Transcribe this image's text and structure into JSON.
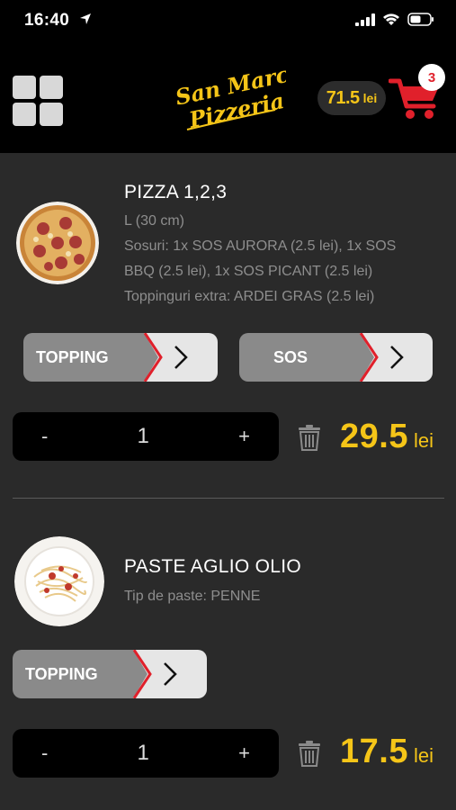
{
  "status": {
    "time": "16:40"
  },
  "header": {
    "logo_line1": "San Marco",
    "logo_line2": "Pizzeria",
    "total_amount": "71.5",
    "total_currency": "lei",
    "cart_count": "3",
    "cart_color": "#e0202b"
  },
  "items": [
    {
      "title": "PIZZA 1,2,3",
      "details": [
        "L (30 cm)",
        "Sosuri: 1x SOS AURORA (2.5 lei), 1x SOS",
        "BBQ (2.5 lei), 1x SOS PICANT (2.5 lei)",
        "Toppinguri extra: ARDEI GRAS (2.5 lei)"
      ],
      "buttons": [
        "TOPPING",
        "SOS"
      ],
      "qty_minus": "-",
      "qty_value": "1",
      "qty_plus": "+",
      "price": "29.5",
      "currency": "lei"
    },
    {
      "title": "PASTE AGLIO OLIO",
      "details": [
        "Tip de paste: PENNE"
      ],
      "buttons": [
        "TOPPING"
      ],
      "qty_minus": "-",
      "qty_value": "1",
      "qty_plus": "+",
      "price": "17.5",
      "currency": "lei"
    }
  ],
  "colors": {
    "accent": "#f5c518",
    "button_grey": "#8a8a8a",
    "arrow_bg": "#e6e6e6"
  }
}
